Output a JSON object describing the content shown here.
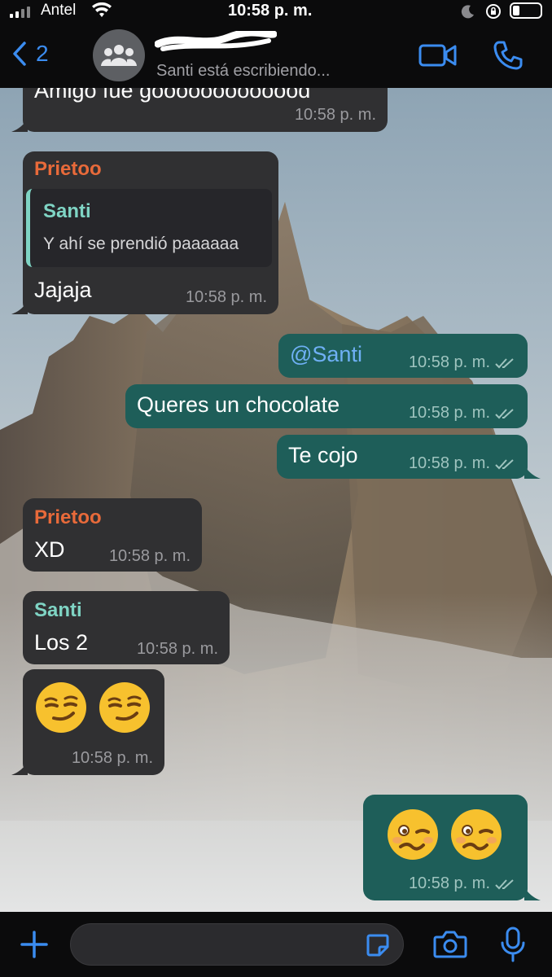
{
  "status_bar": {
    "carrier": "Antel",
    "time": "10:58 p. m."
  },
  "header": {
    "back_count": "2",
    "subtitle": "Santi está escribiendo..."
  },
  "messages": {
    "m0": {
      "text": "Amigo fue gooooooooooood",
      "time": "10:58 p. m."
    },
    "m1": {
      "sender": "Prietoo",
      "quote_sender": "Santi",
      "quote_text": "Y ahí se prendió paaaaaa",
      "text": "Jajaja",
      "time": "10:58 p. m."
    },
    "m2": {
      "text": "@Santi",
      "time": "10:58 p. m."
    },
    "m3": {
      "text": "Queres un chocolate",
      "time": "10:58 p. m."
    },
    "m4": {
      "text": "Te cojo",
      "time": "10:58 p. m."
    },
    "m5": {
      "sender": "Prietoo",
      "text": "XD",
      "time": "10:58 p. m."
    },
    "m6": {
      "sender": "Santi",
      "text": "Los 2",
      "time": "10:58 p. m."
    },
    "m7": {
      "emojis": [
        "smirking-face",
        "smirking-face"
      ],
      "time": "10:58 p. m."
    },
    "m8": {
      "emojis": [
        "woozy-face",
        "woozy-face"
      ],
      "time": "10:58 p. m."
    }
  },
  "composer": {
    "placeholder": ""
  },
  "colors": {
    "accent": "#3b8cf0",
    "incoming_bubble": "#303032",
    "outgoing_bubble": "#1e5e59",
    "sender_orange": "#e86a3a",
    "sender_teal": "#7fd4c4"
  }
}
